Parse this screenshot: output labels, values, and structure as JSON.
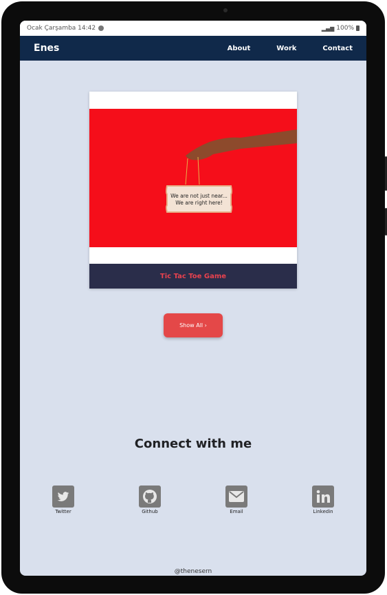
{
  "statusbar": {
    "left_text": "Ocak Çarşamba 14:42",
    "right_text": "100%"
  },
  "navbar": {
    "brand": "Enes",
    "links": [
      "About",
      "Work",
      "Contact"
    ]
  },
  "card": {
    "sign_line1": "We are not just near...",
    "sign_line2": "We are right here!",
    "caption": "Tic Tac Toe Game"
  },
  "show_all": "Show All ›",
  "connect_title": "Connect with me",
  "socials": [
    {
      "label": "Twitter",
      "icon": "twitter-icon"
    },
    {
      "label": "Github",
      "icon": "github-icon"
    },
    {
      "label": "Email",
      "icon": "email-icon"
    },
    {
      "label": "Linkedin",
      "icon": "linkedin-icon"
    }
  ],
  "footer": "@thenesern",
  "colors": {
    "navbar": "#10294a",
    "background": "#d9e0ed",
    "accent": "#e44848",
    "caption_bg": "#2a2d4a"
  }
}
